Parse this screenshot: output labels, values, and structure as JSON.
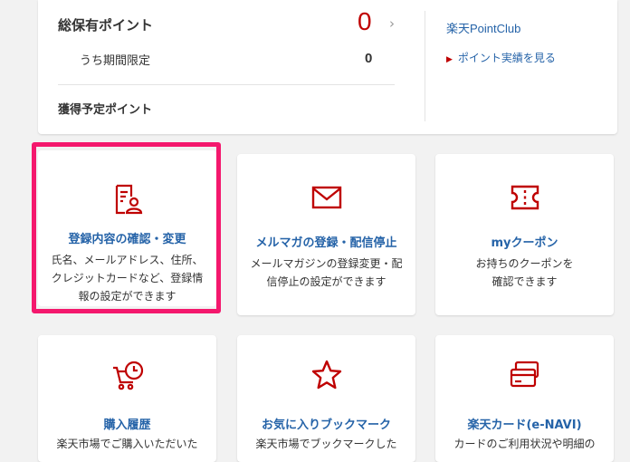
{
  "points": {
    "total_label": "総保有ポイント",
    "total_value": "0",
    "limited_label": "うち期間限定",
    "limited_value": "0",
    "pending_label": "獲得予定ポイント",
    "club_link": "楽天PointClub",
    "history_link": "ポイント実績を見る"
  },
  "tiles": [
    {
      "title": "登録内容の確認・変更",
      "desc": "氏名、メールアドレス、住所、クレジットカードなど、登録情報の設定ができます",
      "icon": "profile-document-icon"
    },
    {
      "title": "メルマガの登録・配信停止",
      "desc": "メールマガジンの登録変更・配信停止の設定ができます",
      "icon": "envelope-icon"
    },
    {
      "title": "myクーポン",
      "desc": "お持ちのクーポンを確認できます",
      "icon": "coupon-ticket-icon"
    },
    {
      "title": "購入履歴",
      "desc": "楽天市場でご購入いただいた",
      "icon": "cart-clock-icon"
    },
    {
      "title": "お気に入りブックマーク",
      "desc": "楽天市場でブックマークした",
      "icon": "star-icon"
    },
    {
      "title": "楽天カード(e-NAVI)",
      "desc": "カードのご利用状況や明細の",
      "icon": "credit-card-icon"
    }
  ],
  "colors": {
    "accent_red": "#bf0000",
    "link_blue": "#2563a8",
    "highlight_pink": "#f4186d"
  }
}
